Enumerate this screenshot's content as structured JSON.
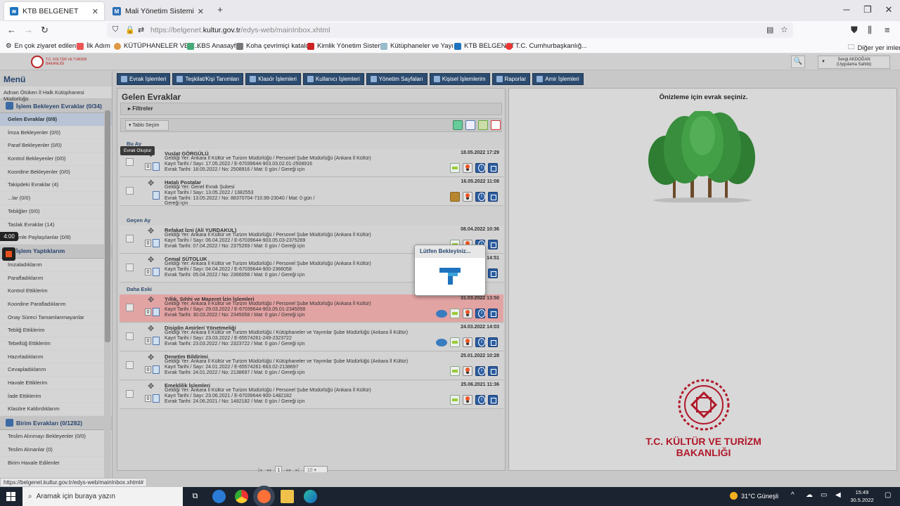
{
  "browser": {
    "tabs": [
      {
        "title": "KTB BELGENET",
        "active": true
      },
      {
        "title": "Mali Yönetim Sistemi",
        "active": false
      }
    ],
    "new_tab": "+",
    "url_prefix": "https://belgenet.",
    "url_domain": "kultur.gov.tr",
    "url_suffix": "/edys-web/mainInbox.xhtml",
    "bookmarks": [
      "En çok ziyaret edilenler",
      "İlk Adım",
      "KÜTÜPHANELER VE Y...",
      "KBS Anasayfa",
      "Koha çevrimiçi katalog",
      "Kimlik Yönetim Sistemi",
      "Kütüphaneler ve Yayı...",
      "KTB BELGENET",
      "T.C. Cumhurbaşkanlığ..."
    ],
    "other_bookmarks": "Diğer yer imleri",
    "status_url": "https://belgenet.kultur.gov.tr/edys-web/mainInbox.xhtml#"
  },
  "header": {
    "user_name": "Sevgi AKDOĞAN",
    "user_role": "(Uygulama Sahibi)"
  },
  "sidebar": {
    "title": "Menü",
    "unit": "Adnan Ötüken İl Halk Kütüphanesi Müdürlüğü",
    "sections": [
      {
        "label": "İşlem Bekleyen Evraklar (0/34)",
        "items": [
          "Gelen Evraklar (0/8)",
          "İmza Bekleyenler (0/0)",
          "Paraf Bekleyenler (0/0)",
          "Kontrol Bekleyenler (0/0)",
          "Koordine Bekleyenler (0/0)",
          "Takipdeki Evraklar (4)",
          "...lar (0/0)",
          "Tebliğler (0/0)",
          "Taslak Evraklar (14)",
          "Benimle Paylaşılanlar (0/8)"
        ]
      },
      {
        "label": "İşlem Yaptıklarım",
        "items": [
          "İmzaladıklarım",
          "Parafladıklarım",
          "Kontrol Ettiklerim",
          "Koordine Parafladıklarım",
          "Onay Süreci Tamamlanmayanlar",
          "Tebliğ Ettiklerim",
          "Tebellüğ Ettiklerim",
          "Hazırladıklarım",
          "Cevapladıklarım",
          "Havale Ettiklerim",
          "İade Ettiklerim",
          "Klasöre Kaldırdıklarım"
        ]
      },
      {
        "label": "Birim Evrakları (0/1282)",
        "items": [
          "Teslim Alınmayı Bekleyenler (0/0)",
          "Teslim Alınanlar (0)",
          "Birim Havale Edilenler"
        ]
      }
    ]
  },
  "recording": {
    "time": "4:00"
  },
  "topmenu": [
    "Evrak İşlemleri",
    "Teşkilat/Kişi Tanımları",
    "Klasör İşlemleri",
    "Kullanıcı İşlemleri",
    "Yönetim Sayfaları",
    "Kişisel İşlemlerim",
    "Raporlar",
    "Amir İşlemleri"
  ],
  "inbox": {
    "title": "Gelen Evraklar",
    "filters": "Filtreler",
    "table_select": "Tablo Seçim",
    "tooltip": "Evrak Oluştur",
    "groups": [
      {
        "label": "Bu Ay",
        "rows": [
          {
            "subject": "Vuslat GÖRGÜLÜ",
            "from": "Geldiği Yer: Ankara İl Kültür ve Turizm Müdürlüğü / Personel Şube Müdürlüğü (Ankara İl Kültür)",
            "reg": "Kayıt Tarihi / Sayı: 17.05.2022 / E-67039644-903.03.02.01-2508916",
            "doc": "Evrak Tarihi: 18.05.2022 / No: 2508916 / Mat: 0 gün / Gereği için",
            "date": "18.05.2022 17:29",
            "count": "0"
          },
          {
            "subject": "Hatalı Postalar",
            "from": "Geldiği Yer: Genel Evrak Şubesi",
            "reg": "Kayıt Tarihi / Sayı: 13.05.2022 / 1382553",
            "doc": "Evrak Tarihi: 13.05.2022 / No: 88370704-710.99-23040 / Mat: 0 gün /",
            "doc2": "Gereği için",
            "date": "16.05.2022 11:08",
            "count": ""
          }
        ]
      },
      {
        "label": "Geçen Ay",
        "rows": [
          {
            "subject": "Refakat İzni (Ali YURDAKUL)",
            "from": "Geldiği Yer: Ankara İl Kültür ve Turizm Müdürlüğü / Personel Şube Müdürlüğü (Ankara İl Kültür)",
            "reg": "Kayıt Tarihi / Sayı: 06.04.2022 / E-67039644-903.05.03-2375269",
            "doc": "Evrak Tarihi: 07.04.2022 / No: 2375269 / Mat: 0 gün / Gereği için",
            "date": "08.04.2022 10:36",
            "count": "0"
          },
          {
            "subject": "Cemal SÜTOLUK",
            "from": "Geldiği Yer: Ankara İl Kültür ve Turizm Müdürlüğü / Personel Şube Müdürlüğü (Ankara İl Kültür)",
            "reg": "Kayıt Tarihi / Sayı: 04.04.2022 / E-67039644-900-2366058",
            "doc": "Evrak Tarihi: 05.04.2022 / No: 2366058 / Mat: 0 gün / Gereği için",
            "date": "14:51",
            "count": "0"
          }
        ]
      },
      {
        "label": "Daha Eski",
        "rows": [
          {
            "subject": "Yıllık, Sıhhi ve Mazeret İzin İşlemleri",
            "from": "Geldiği Yer: Ankara İl Kültür ve Turizm Müdürlüğü / Personel Şube Müdürlüğü (Ankara İl Kültür)",
            "reg": "Kayıt Tarihi / Sayı: 29.03.2022 / E-67039644-903.05.01-2345058",
            "doc": "Evrak Tarihi: 30.03.2022 / No: 2345058 / Mat: 0 gün / Gereği için",
            "date": "31.03.2022 13:50",
            "count": "0"
          },
          {
            "subject": "Disiplin Amirleri Yönetmeliği",
            "from": "Geldiği Yer: Ankara İl Kültür ve Turizm Müdürlüğü / Kütüphaneler ve Yayımlar Şube Müdürlüğü (Ankara İl Kültür)",
            "reg": "Kayıt Tarihi / Sayı: 23.03.2022 / E-65574261-249-2323722",
            "doc": "Evrak Tarihi: 23.03.2022 / No: 2323722 / Mat: 0 gün / Gereği için",
            "date": "24.03.2022 14:03",
            "count": "0"
          },
          {
            "subject": "Denetim Bildirimi",
            "from": "Geldiği Yer: Ankara İl Kültür ve Turizm Müdürlüğü / Kütüphaneler ve Yayımlar Şube Müdürlüğü (Ankara İl Kültür)",
            "reg": "Kayıt Tarihi / Sayı: 24.01.2022 / E-65574261-663.02-2138697",
            "doc": "Evrak Tarihi: 24.01.2022 / No: 2138697 / Mat: 0 gün / Gereği için",
            "date": "25.01.2022 10:28",
            "count": "0"
          },
          {
            "subject": "Emeklilik İşlemleri",
            "from": "Geldiği Yer: Ankara İl Kültür ve Turizm Müdürlüğü / Personel Şube Müdürlüğü (Ankara İl Kültür)",
            "reg": "Kayıt Tarihi / Sayı: 23.06.2021 / E-67039644-900-1482182",
            "doc": "Evrak Tarihi: 24.06.2021 / No: 1482182 / Mat: 0 gün / Gereği için",
            "date": "25.06.2021 11:36",
            "count": "0"
          }
        ]
      }
    ],
    "pager": {
      "page": "1",
      "size": "10"
    }
  },
  "loading": {
    "title": "Lütfen Bekleyiniz..."
  },
  "preview": {
    "title": "Önizleme için evrak seçiniz.",
    "ministry_line1": "T.C. KÜLTÜR VE TURİZM",
    "ministry_line2": "BAKANLIĞI"
  },
  "taskbar": {
    "search_placeholder": "Aramak için buraya yazın",
    "weather": "31°C  Güneşli",
    "time": "15:49",
    "date": "30.5.2022"
  },
  "colors": {
    "menu_bar": "#2c4b6f",
    "highlight_row": "#e2a3a3",
    "ministry_red": "#b0182a"
  }
}
